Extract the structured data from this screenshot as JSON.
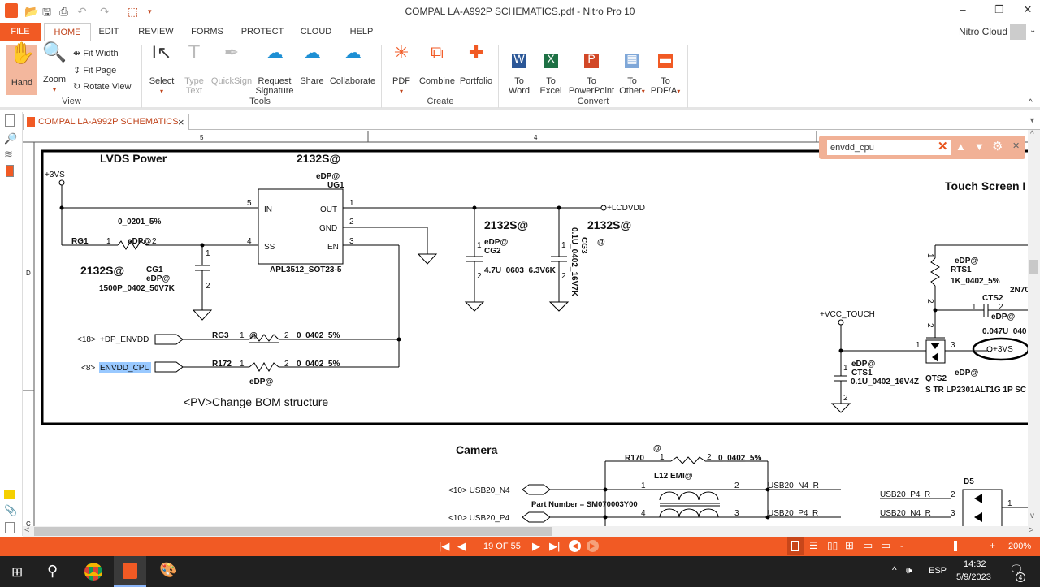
{
  "window": {
    "title": "COMPAL LA-A992P SCHEMATICS.pdf - Nitro Pro 10",
    "minimize": "–",
    "restore": "❐",
    "close": "✕"
  },
  "quick_access": {
    "icons": [
      "app-logo-icon",
      "open-folder-icon",
      "save-icon",
      "print-icon",
      "undo-icon",
      "redo-icon",
      "select-tool-icon",
      "customize-icon"
    ]
  },
  "menu": {
    "tabs": [
      "FILE",
      "HOME",
      "EDIT",
      "REVIEW",
      "FORMS",
      "PROTECT",
      "CLOUD",
      "HELP"
    ],
    "active": "HOME",
    "account": "Nitro Cloud"
  },
  "ribbon": {
    "view": {
      "group": "View",
      "hand": "Hand",
      "zoom": "Zoom",
      "fit_width": "Fit Width",
      "fit_page": "Fit Page",
      "rotate_view": "Rotate View"
    },
    "tools": {
      "group": "Tools",
      "select": "Select",
      "type_text": [
        "Type",
        "Text"
      ],
      "quicksign": "QuickSign",
      "request_signature": [
        "Request",
        "Signature"
      ],
      "share": "Share",
      "collaborate": "Collaborate"
    },
    "create": {
      "group": "Create",
      "pdf": "PDF",
      "combine": "Combine",
      "portfolio": "Portfolio"
    },
    "convert": {
      "group": "Convert",
      "to_word": [
        "To",
        "Word"
      ],
      "to_excel": [
        "To",
        "Excel"
      ],
      "to_powerpoint": [
        "To",
        "PowerPoint"
      ],
      "to_other": [
        "To",
        "Other"
      ],
      "to_pdfa": [
        "To",
        "PDF/A"
      ]
    }
  },
  "document_tab": {
    "label": "COMPAL LA-A992P SCHEMATICS",
    "close": "×"
  },
  "find": {
    "value": "envdd_cpu",
    "clear": "✕",
    "prev": "▲",
    "next": "▼",
    "settings": "⚙",
    "close": "✕"
  },
  "schematic": {
    "ruler": {
      "col5": "5",
      "col4": "4",
      "rowD": "D",
      "rowC": "C"
    },
    "lvds": {
      "title": "LVDS Power",
      "variant_top": "2132S@",
      "vs": "+3VS",
      "ug1_opt": "eDP@",
      "ug1": "UG1",
      "ug1_part": "APL3512_SOT23-5",
      "pins": {
        "in": "IN",
        "out": "OUT",
        "gnd": "GND",
        "en": "EN",
        "ss": "SS",
        "p5": "5",
        "p4": "4",
        "p1": "1",
        "p2": "2",
        "p3": "3"
      },
      "rg1_val": "0_0201_5%",
      "rg1": "RG1",
      "rg1_p1": "1",
      "rg1_opt": "eDP@",
      "rg1_p2": "2",
      "cg1_variant": "2132S@",
      "cg1": "CG1",
      "cg1_opt": "eDP@",
      "cg1_val": "1500P_0402_50V7K",
      "cg1_p1": "1",
      "cg1_p2": "2",
      "lcdvdd": "+LCDVDD",
      "cg2_variant": "2132S@",
      "cg2_opt": "eDP@",
      "cg2": "CG2",
      "cg2_val": "4.7U_0603_6.3V6K",
      "cg2_p1": "1",
      "cg2_p2": "2",
      "cg3_variant": "2132S@",
      "cg3_opt": "@",
      "cg3": "CG3",
      "cg3_val": "0.1U_0402_16V7K",
      "cg3_p1": "1",
      "cg3_p2": "2",
      "dp_ref": "<18>",
      "dp_net": "+DP_ENVDD",
      "rg3": "RG3",
      "rg3_p1": "1",
      "rg3_opt": "@",
      "rg3_p2": "2",
      "rg3_val": "0_0402_5%",
      "cpu_ref": "<8>",
      "cpu_net": "ENVDD_CPU",
      "r172": "R172",
      "r172_p1": "1",
      "r172_p2": "2",
      "r172_val": "0_0402_5%",
      "r172_opt": "eDP@",
      "note": "<PV>Change BOM structure"
    },
    "touch": {
      "title": "Touch Screen I",
      "rts1_opt": "eDP@",
      "rts1": "RTS1",
      "rts1_val": "1K_0402_5%",
      "rts1_p1": "1",
      "rts1_p2": "2",
      "q_label": "2N70",
      "cts2": "CTS2",
      "cts2_p1": "1",
      "cts2_p2": "2",
      "cts2_opt": "eDP@",
      "cts2_val": "0.047U_040",
      "vcc": "+VCC_TOUCH",
      "qts2_p2": "2",
      "qts2_p1": "1",
      "qts2_p3": "3",
      "vs": "+3VS",
      "cts1_p1": "1",
      "cts1_opt": "eDP@",
      "cts1": "CTS1",
      "cts1_val": "0.1U_0402_16V4Z",
      "cts1_p2": "2",
      "qts2": "QTS2",
      "qts2_opt": "eDP@",
      "qts2_part": "S TR LP2301ALT1G 1P SC"
    },
    "camera": {
      "title": "Camera",
      "r170_opt": "@",
      "r170": "R170",
      "r170_p1": "1",
      "r170_p2": "2",
      "r170_val": "0_0402_5%",
      "l12": "L12  EMI@",
      "n4_ref": "<10> USB20_N4",
      "p4_ref": "<10> USB20_P4",
      "l_p1": "1",
      "l_p2": "2",
      "l_p3": "3",
      "l_p4": "4",
      "n4_r": "USB20_N4_R",
      "p4_r": "USB20_P4_R",
      "part_number": "Part Number = SM070003Y00",
      "d5": "D5",
      "d5_in1": "USB20_P4_R",
      "d5_p2": "2",
      "d5_in2": "USB20_N4_R",
      "d5_p3": "3",
      "d5_p1": "1"
    }
  },
  "statusbar": {
    "page": "19 OF 55",
    "zoom": "200%",
    "zoom_minus": "-",
    "zoom_plus": "+",
    "zoom_level_percent": 200
  },
  "taskbar": {
    "lang": "ESP",
    "time": "14:32",
    "date": "5/9/2023",
    "notifications": "4"
  },
  "colors": {
    "accent": "#f15a24",
    "find_bar": "#f1b196",
    "highlight": "#99c9ff",
    "taskbar": "#202020"
  }
}
